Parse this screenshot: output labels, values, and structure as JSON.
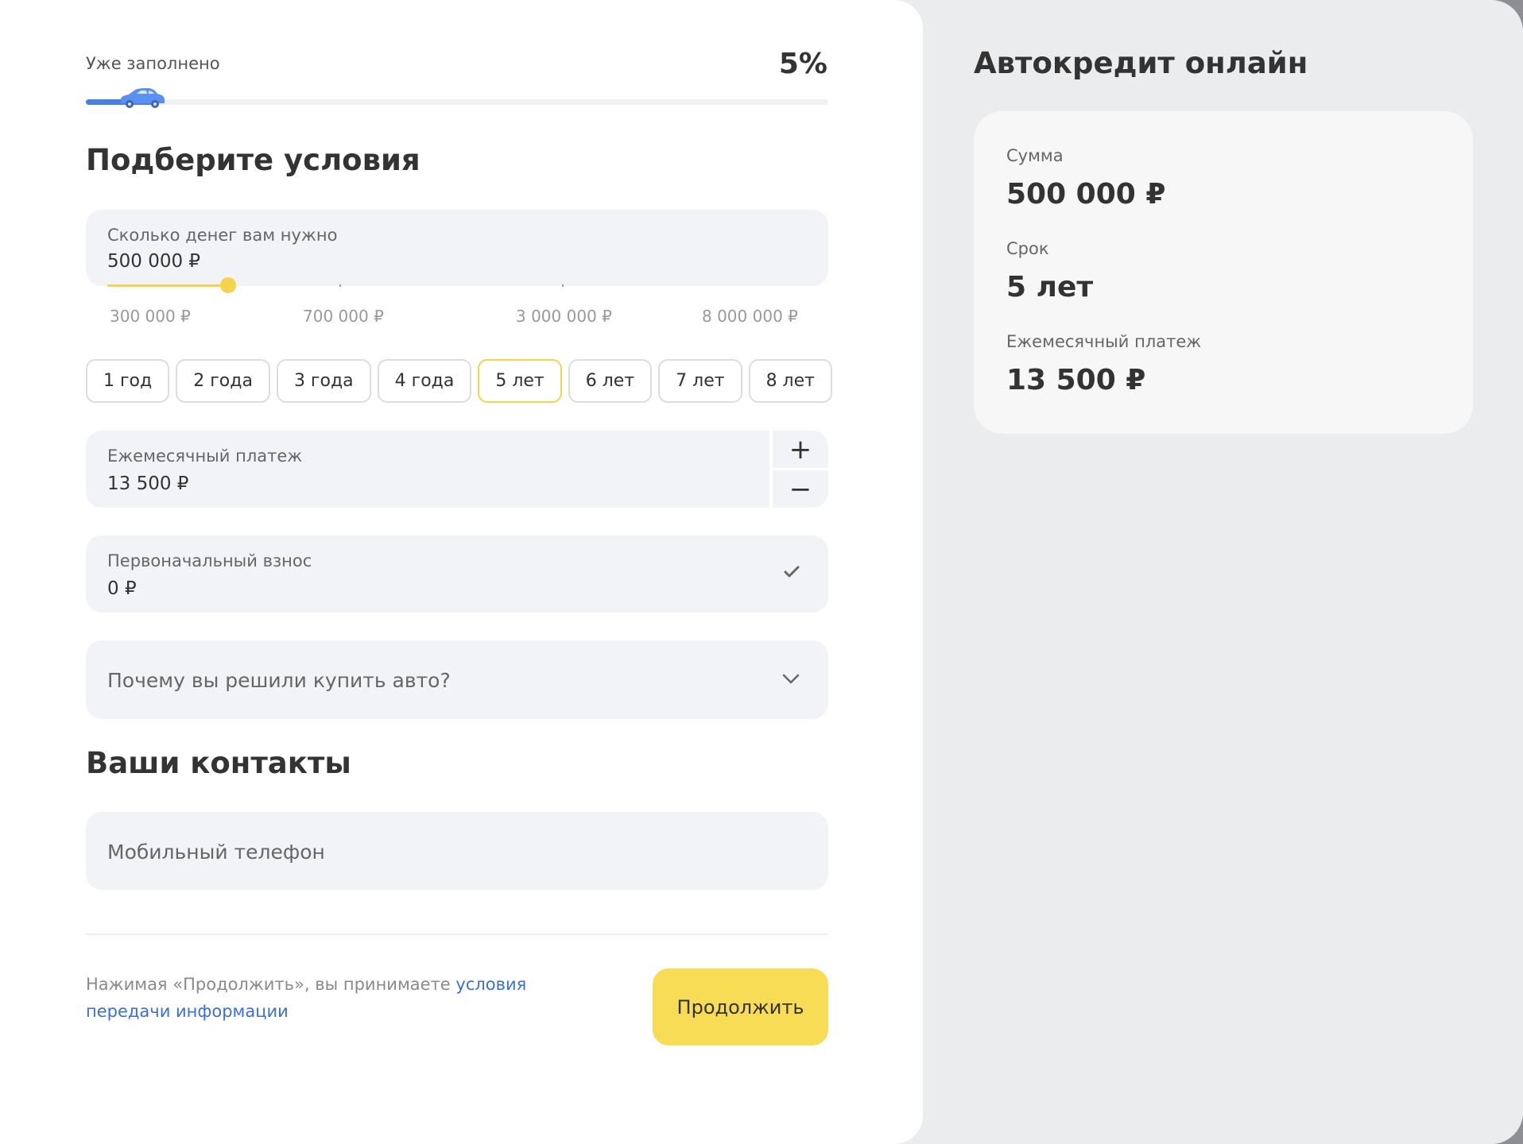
{
  "progress": {
    "label": "Уже заполнено",
    "value_text": "5%",
    "fraction": 0.05
  },
  "conditions": {
    "title": "Подберите условия",
    "amount": {
      "label": "Сколько денег вам нужно",
      "value": "500 000 ₽",
      "scale_labels": [
        "300 000 ₽",
        "700 000 ₽",
        "3 000 000 ₽",
        "8 000 000 ₽"
      ]
    },
    "terms": [
      "1 год",
      "2 года",
      "3 года",
      "4 года",
      "5 лет",
      "6 лет",
      "7 лет",
      "8 лет"
    ],
    "selected_term": "5 лет",
    "monthly_payment": {
      "label": "Ежемесячный платеж",
      "value": "13 500 ₽",
      "plus": "+",
      "minus": "−"
    },
    "down_payment": {
      "label": "Первоначальный взнос",
      "value": "0 ₽"
    },
    "reason_select": {
      "value": "Почему вы решили купить авто?"
    }
  },
  "contacts": {
    "title": "Ваши контакты",
    "phone_placeholder": "Мобильный телефон"
  },
  "footer": {
    "consent_text": "Нажимая «Продолжить», вы принимаете ",
    "consent_link": "условия передачи информации",
    "continue_label": "Продолжить"
  },
  "summary": {
    "title": "Автокредит онлайн",
    "sum_label": "Сумма",
    "sum_value": "500 000 ₽",
    "term_label": "Срок",
    "term_value": "5 лет",
    "payment_label": "Ежемесячный платеж",
    "payment_value": "13 500 ₽"
  },
  "colors": {
    "accent_yellow": "#f8dc55",
    "progress_blue": "#4b7fe8",
    "link_blue": "#3a6fd6"
  },
  "icons": [
    "car-icon",
    "check-icon",
    "chevron-down-icon"
  ]
}
